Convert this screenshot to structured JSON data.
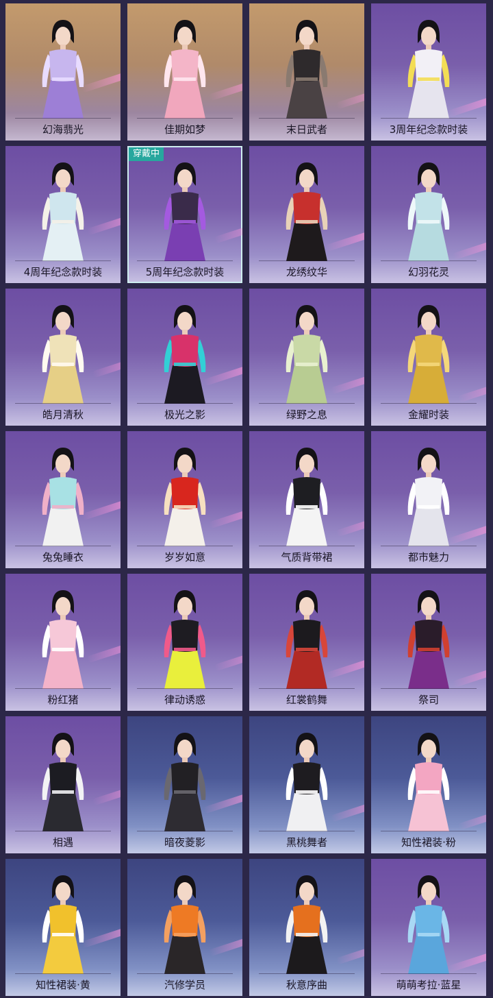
{
  "badge_text": "穿戴中",
  "outfits": [
    {
      "name": "幻海翡光",
      "bg": "warm",
      "top": "#c7b6ee",
      "bottom": "#9d7fd6",
      "accent": "#e8dcff",
      "equipped": false
    },
    {
      "name": "佳期如梦",
      "bg": "warm",
      "top": "#f4b5c8",
      "bottom": "#f1a7bd",
      "accent": "#ffe6ee",
      "equipped": false
    },
    {
      "name": "末日武者",
      "bg": "warm",
      "top": "#2e2a2c",
      "bottom": "#4a4244",
      "accent": "#8a7a70",
      "equipped": false
    },
    {
      "name": "3周年纪念款时装",
      "bg": "purple",
      "top": "#f2f0f6",
      "bottom": "#e6e4ee",
      "accent": "#f3dd55",
      "equipped": false
    },
    {
      "name": "4周年纪念款时装",
      "bg": "purple",
      "top": "#cfe6ee",
      "bottom": "#e4f0f4",
      "accent": "#f4f1e8",
      "equipped": false
    },
    {
      "name": "5周年纪念款时装",
      "bg": "purple",
      "top": "#3a2b4a",
      "bottom": "#7a3fb2",
      "accent": "#a45ae0",
      "equipped": true
    },
    {
      "name": "龙绣纹华",
      "bg": "purple",
      "top": "#c7302d",
      "bottom": "#1e1a1c",
      "accent": "#e8d2b8",
      "equipped": false
    },
    {
      "name": "幻羽花灵",
      "bg": "purple",
      "top": "#c2e2e8",
      "bottom": "#b6dbe0",
      "accent": "#eef8fa",
      "equipped": false
    },
    {
      "name": "皓月清秋",
      "bg": "purple",
      "top": "#efe2b8",
      "bottom": "#e6cf86",
      "accent": "#fffaf0",
      "equipped": false
    },
    {
      "name": "极光之影",
      "bg": "purple",
      "top": "#d8326a",
      "bottom": "#1c1a22",
      "accent": "#32d0d6",
      "equipped": false
    },
    {
      "name": "绿野之息",
      "bg": "purple",
      "top": "#c9d9a6",
      "bottom": "#b8cc92",
      "accent": "#e8f0d0",
      "equipped": false
    },
    {
      "name": "金耀时装",
      "bg": "purple",
      "top": "#e0b94a",
      "bottom": "#d7ad38",
      "accent": "#f4d77a",
      "equipped": false
    },
    {
      "name": "兔兔睡衣",
      "bg": "purple",
      "top": "#a8e1e4",
      "bottom": "#f1f1f1",
      "accent": "#f0b0c8",
      "equipped": false
    },
    {
      "name": "岁岁如意",
      "bg": "purple",
      "top": "#d8261e",
      "bottom": "#f4f0ea",
      "accent": "#f7e0c0",
      "equipped": false
    },
    {
      "name": "气质背带裙",
      "bg": "purple",
      "top": "#1e1e22",
      "bottom": "#f4f4f4",
      "accent": "#ffffff",
      "equipped": false
    },
    {
      "name": "都市魅力",
      "bg": "purple",
      "top": "#f2f2f6",
      "bottom": "#e4e4ec",
      "accent": "#ffffff",
      "equipped": false
    },
    {
      "name": "粉红猪",
      "bg": "purple",
      "top": "#f6c8d8",
      "bottom": "#f3b3c9",
      "accent": "#ffffff",
      "equipped": false
    },
    {
      "name": "律动诱惑",
      "bg": "purple",
      "top": "#1e1c22",
      "bottom": "#e9ef3c",
      "accent": "#f05a8a",
      "equipped": false
    },
    {
      "name": "红裳鹤舞",
      "bg": "purple",
      "top": "#1c1a1e",
      "bottom": "#b22a24",
      "accent": "#d8463a",
      "equipped": false
    },
    {
      "name": "祭司",
      "bg": "purple",
      "top": "#2a1c2a",
      "bottom": "#7a2e8a",
      "accent": "#d04030",
      "equipped": false
    },
    {
      "name": "相遇",
      "bg": "purple",
      "top": "#1c1c22",
      "bottom": "#2a2a30",
      "accent": "#f2f2f4",
      "equipped": false
    },
    {
      "name": "暗夜菱影",
      "bg": "blue",
      "top": "#222024",
      "bottom": "#2e2c32",
      "accent": "#6a6870",
      "equipped": false
    },
    {
      "name": "黑桃舞者",
      "bg": "blue",
      "top": "#1e1c20",
      "bottom": "#f0f0f2",
      "accent": "#ffffff",
      "equipped": false
    },
    {
      "name": "知性裙装·粉",
      "bg": "blue",
      "top": "#f3a6c2",
      "bottom": "#f6c2d4",
      "accent": "#ffffff",
      "equipped": false
    },
    {
      "name": "知性裙装·黄",
      "bg": "blue",
      "top": "#f1c12c",
      "bottom": "#f3cb3e",
      "accent": "#ffffff",
      "equipped": false
    },
    {
      "name": "汽修学员",
      "bg": "blue",
      "top": "#ee7a24",
      "bottom": "#2a2628",
      "accent": "#f4a060",
      "equipped": false
    },
    {
      "name": "秋意序曲",
      "bg": "blue",
      "top": "#e5701e",
      "bottom": "#1c1a1c",
      "accent": "#f2f2f2",
      "equipped": false
    },
    {
      "name": "萌萌考拉·蓝星",
      "bg": "purple",
      "top": "#6ab6e6",
      "bottom": "#5aa6dc",
      "accent": "#a8d8f4",
      "equipped": false
    }
  ]
}
